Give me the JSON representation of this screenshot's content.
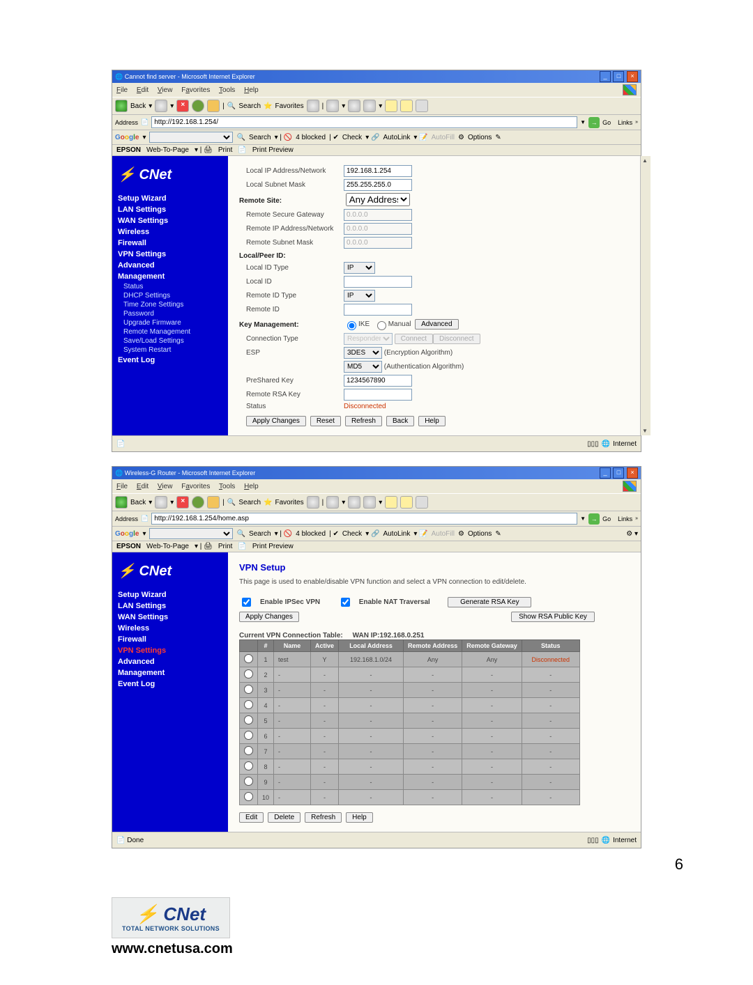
{
  "page_number": "6",
  "footer": {
    "url": "www.cnetusa.com",
    "sub": "TOTAL NETWORK SOLUTIONS"
  },
  "shot1": {
    "title": "Cannot find server - Microsoft Internet Explorer",
    "menu": [
      "File",
      "Edit",
      "View",
      "Favorites",
      "Tools",
      "Help"
    ],
    "tb": {
      "back": "Back",
      "search": "Search",
      "fav": "Favorites"
    },
    "address_label": "Address",
    "url": "http://192.168.1.254/",
    "go": "Go",
    "links": "Links",
    "google_label": "Google",
    "g_items": [
      "Search",
      "4 blocked",
      "Check",
      "AutoLink",
      "AutoFill",
      "Options"
    ],
    "epson": {
      "brand": "EPSON",
      "wtp": "Web-To-Page",
      "print": "Print",
      "pp": "Print Preview"
    },
    "brand": "CNet",
    "nav": [
      "Setup Wizard",
      "LAN Settings",
      "WAN Settings",
      "Wireless",
      "Firewall",
      "VPN Settings",
      "Advanced",
      "Management"
    ],
    "navsub": [
      "Status",
      "DHCP Settings",
      "Time Zone Settings",
      "Password",
      "Upgrade Firmware",
      "Remote Management",
      "Save/Load Settings",
      "System Restart"
    ],
    "nav_last": "Event Log",
    "form": {
      "localip_l": "Local IP Address/Network",
      "localip_v": "192.168.1.254",
      "localmask_l": "Local Subnet Mask",
      "localmask_v": "255.255.255.0",
      "remote_hdr": "Remote Site:",
      "rsg_l": "Remote Secure Gateway",
      "rsg_v": "0.0.0.0",
      "rip_l": "Remote IP Address/Network",
      "rip_v": "0.0.0.0",
      "rmask_l": "Remote Subnet Mask",
      "rmask_v": "0.0.0.0",
      "peer_hdr": "Local/Peer ID:",
      "lidt_l": "Local ID Type",
      "lidt_v": "IP",
      "lid_l": "Local ID",
      "ridt_l": "Remote ID Type",
      "ridt_v": "IP",
      "rid_l": "Remote ID",
      "key_hdr": "Key Management:",
      "ike": "IKE",
      "manual": "Manual",
      "adv": "Advanced",
      "ct_l": "Connection Type",
      "ct_v": "Responder",
      "connect": "Connect",
      "disconnect": "Disconnect",
      "esp_l": "ESP",
      "esp1": "3DES",
      "esp1_note": "(Encryption Algorithm)",
      "esp2": "MD5",
      "esp2_note": "(Authentication Algorithm)",
      "psk_l": "PreShared Key",
      "psk_v": "1234567890",
      "rrk_l": "Remote RSA Key",
      "stat_l": "Status",
      "stat_v": "Disconnected",
      "btns": [
        "Apply Changes",
        "Reset",
        "Refresh",
        "Back",
        "Help"
      ]
    },
    "remote_site_opt": "Any Address",
    "status_internet": "Internet"
  },
  "shot2": {
    "title": "Wireless-G Router - Microsoft Internet Explorer",
    "menu": [
      "File",
      "Edit",
      "View",
      "Favorites",
      "Tools",
      "Help"
    ],
    "tb": {
      "back": "Back",
      "search": "Search",
      "fav": "Favorites"
    },
    "address_label": "Address",
    "url": "http://192.168.1.254/home.asp",
    "go": "Go",
    "links": "Links",
    "google_label": "Google",
    "g_items": [
      "Search",
      "4 blocked",
      "Check",
      "AutoLink",
      "AutoFill",
      "Options"
    ],
    "epson": {
      "brand": "EPSON",
      "wtp": "Web-To-Page",
      "print": "Print",
      "pp": "Print Preview"
    },
    "brand": "CNet",
    "nav": [
      "Setup Wizard",
      "LAN Settings",
      "WAN Settings",
      "Wireless",
      "Firewall",
      "VPN Settings",
      "Advanced",
      "Management",
      "Event Log"
    ],
    "nav_active_idx": 5,
    "heading": "VPN Setup",
    "desc": "This page is used to enable/disable VPN function and select a VPN connection to edit/delete.",
    "cb1": "Enable IPSec VPN",
    "cb2": "Enable NAT Traversal",
    "gen": "Generate RSA Key",
    "show": "Show RSA Public Key",
    "apply": "Apply Changes",
    "tablabel": "Current VPN Connection Table:",
    "wanip": "WAN IP:192.168.0.251",
    "headers": [
      "#",
      "Name",
      "Active",
      "Local Address",
      "Remote Address",
      "Remote Gateway",
      "Status"
    ],
    "rows": [
      {
        "n": "1",
        "name": "test",
        "active": "Y",
        "la": "192.168.1.0/24",
        "ra": "Any",
        "rg": "Any",
        "st": "Disconnected"
      },
      {
        "n": "2",
        "name": "-",
        "active": "-",
        "la": "-",
        "ra": "-",
        "rg": "-",
        "st": "-"
      },
      {
        "n": "3",
        "name": "-",
        "active": "-",
        "la": "-",
        "ra": "-",
        "rg": "-",
        "st": "-"
      },
      {
        "n": "4",
        "name": "-",
        "active": "-",
        "la": "-",
        "ra": "-",
        "rg": "-",
        "st": "-"
      },
      {
        "n": "5",
        "name": "-",
        "active": "-",
        "la": "-",
        "ra": "-",
        "rg": "-",
        "st": "-"
      },
      {
        "n": "6",
        "name": "-",
        "active": "-",
        "la": "-",
        "ra": "-",
        "rg": "-",
        "st": "-"
      },
      {
        "n": "7",
        "name": "-",
        "active": "-",
        "la": "-",
        "ra": "-",
        "rg": "-",
        "st": "-"
      },
      {
        "n": "8",
        "name": "-",
        "active": "-",
        "la": "-",
        "ra": "-",
        "rg": "-",
        "st": "-"
      },
      {
        "n": "9",
        "name": "-",
        "active": "-",
        "la": "-",
        "ra": "-",
        "rg": "-",
        "st": "-"
      },
      {
        "n": "10",
        "name": "-",
        "active": "-",
        "la": "-",
        "ra": "-",
        "rg": "-",
        "st": "-"
      }
    ],
    "btns": [
      "Edit",
      "Delete",
      "Refresh",
      "Help"
    ],
    "status_done": "Done",
    "status_internet": "Internet"
  }
}
